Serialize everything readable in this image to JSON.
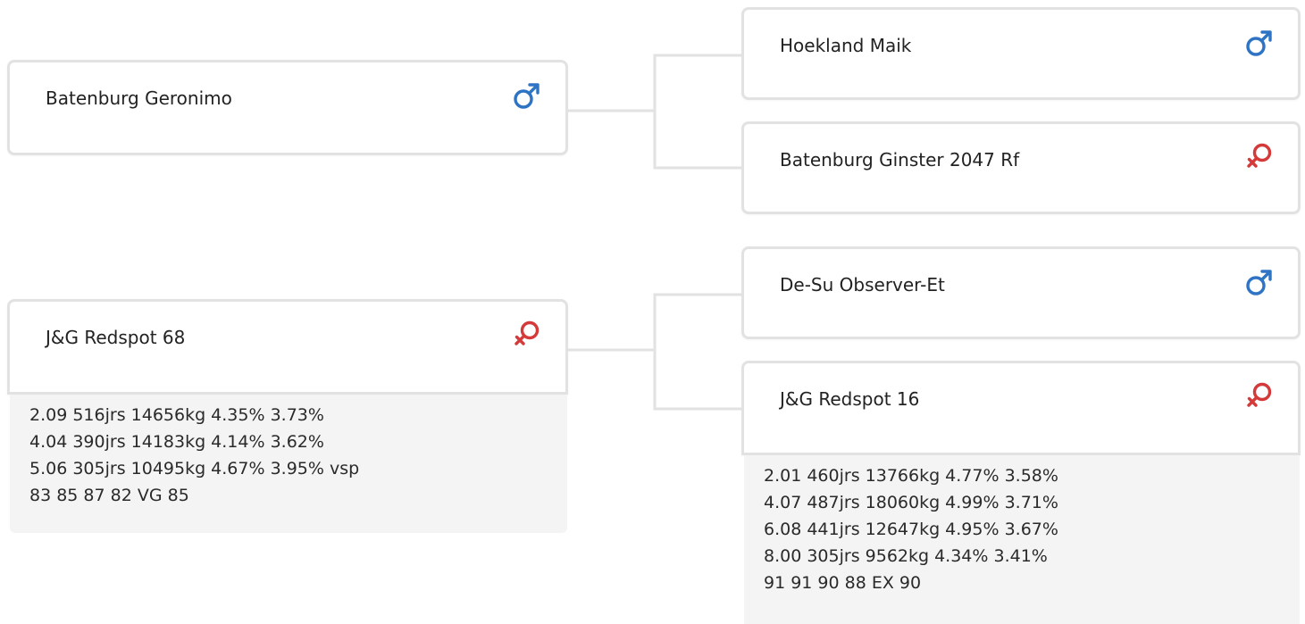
{
  "colors": {
    "male": "#2e73c4",
    "female": "#d43a3a",
    "border": "#e2e2e2",
    "connector": "#e2e2e2",
    "info_bg": "#f4f4f4"
  },
  "parents": {
    "sire": {
      "name": "Batenburg Geronimo",
      "sex_icon": "male-icon"
    },
    "dam": {
      "name": "J&G Redspot 68",
      "sex_icon": "female-icon",
      "info": [
        "2.09 516jrs 14656kg 4.35% 3.73%",
        "4.04 390jrs 14183kg 4.14% 3.62%",
        "5.06 305jrs 10495kg 4.67% 3.95% vsp",
        "83 85 87 82 VG 85"
      ]
    }
  },
  "grandparents": {
    "sire_sire": {
      "name": "Hoekland Maik",
      "sex_icon": "male-icon"
    },
    "sire_dam": {
      "name": "Batenburg Ginster 2047 Rf",
      "sex_icon": "female-icon"
    },
    "dam_sire": {
      "name": "De-Su Observer-Et",
      "sex_icon": "male-icon"
    },
    "dam_dam": {
      "name": "J&G Redspot 16",
      "sex_icon": "female-icon",
      "info": [
        "2.01 460jrs 13766kg 4.77% 3.58%",
        "4.07 487jrs 18060kg 4.99% 3.71%",
        "6.08 441jrs 12647kg 4.95% 3.67%",
        "8.00 305jrs 9562kg 4.34% 3.41%",
        "91 91 90 88 EX 90"
      ]
    }
  }
}
